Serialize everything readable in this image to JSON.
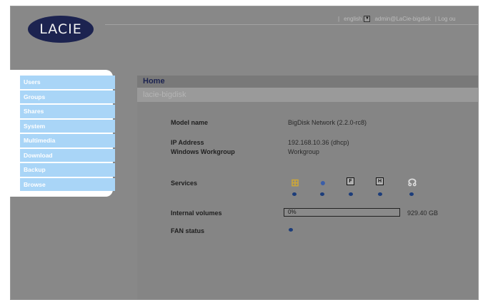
{
  "header": {
    "logo_text": "LACIE",
    "separator": "|",
    "language": "english",
    "user_text": "admin@LaCie-bigdisk",
    "logout": "| Log ou"
  },
  "sidebar": {
    "items": [
      {
        "label": "Users"
      },
      {
        "label": "Groups"
      },
      {
        "label": "Shares"
      },
      {
        "label": "System"
      },
      {
        "label": "Multimedia"
      },
      {
        "label": "Download"
      },
      {
        "label": "Backup"
      },
      {
        "label": "Browse"
      }
    ]
  },
  "main": {
    "breadcrumb": "Home",
    "hostname": "lacie-bigdisk",
    "model_label": "Model name",
    "model_value": "BigDisk Network (2.2.0-rc8)",
    "ip_label": "IP Address",
    "ip_value": "192.168.10.36 (dhcp)",
    "workgroup_label": "Windows Workgroup",
    "workgroup_value": "Workgroup",
    "services_label": "Services",
    "services": [
      {
        "icon": "windows-icon",
        "glyph": "⊞",
        "color": "#c9a53c"
      },
      {
        "icon": "apple-icon",
        "glyph": "●",
        "color": "#3b5ea8"
      },
      {
        "icon": "ftp-icon",
        "glyph": "F",
        "color": "#111111"
      },
      {
        "icon": "http-icon",
        "glyph": "H",
        "color": "#111111"
      },
      {
        "icon": "upnp-icon",
        "glyph": "☊",
        "color": "#dddddd"
      }
    ],
    "volumes_label": "Internal volumes",
    "volume_percent_text": "0%",
    "volume_percent": 0,
    "volume_size": "929.40 GB",
    "fan_label": "FAN status",
    "status_dot_color": "#1c3d7a"
  }
}
